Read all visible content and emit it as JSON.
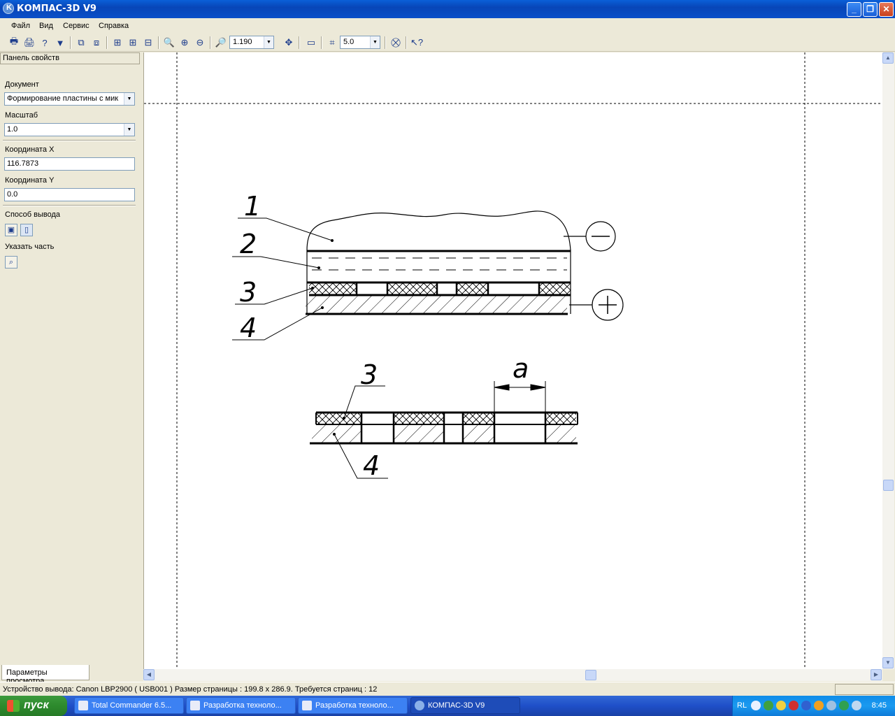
{
  "window": {
    "title": "КОМПАС-3D V9"
  },
  "menu": [
    "Файл",
    "Вид",
    "Сервис",
    "Справка"
  ],
  "toolbar": {
    "zoom_value": "1.190",
    "step_value": "5.0"
  },
  "panel": {
    "title": "Панель свойств",
    "document_label": "Документ",
    "document_value": "Формирование пластины с мик",
    "scale_label": "Масштаб",
    "scale_value": "1.0",
    "coord_x_label": "Координата X",
    "coord_x_value": "116.7873",
    "coord_y_label": "Координата Y",
    "coord_y_value": "0.0",
    "output_label": "Способ вывода",
    "part_label": "Указать часть",
    "tab_label": "Параметры просмотра"
  },
  "drawing": {
    "labels": [
      "1",
      "2",
      "3",
      "4",
      "3",
      "4",
      "a"
    ]
  },
  "status": {
    "text": "Устройство вывода: Canon LBP2900 ( USB001 )  Размер страницы : 199.8 x 286.9.  Требуется страниц : 12"
  },
  "taskbar": {
    "start": "пуск",
    "tasks": [
      "Total Commander 6.5...",
      "Разработка техноло...",
      "Разработка техноло...",
      "КОМПАС-3D V9"
    ],
    "lang": "RL",
    "clock": "8:45"
  }
}
